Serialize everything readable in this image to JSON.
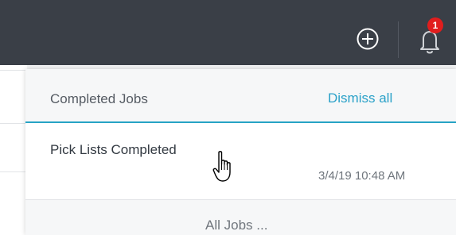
{
  "header": {
    "add_icon": "plus-circle-icon",
    "bell_icon": "bell-icon",
    "notification_count": "1"
  },
  "notifications": {
    "title": "Completed Jobs",
    "dismiss_label": "Dismiss all",
    "items": [
      {
        "title": "Pick Lists Completed",
        "timestamp": "3/4/19 10:48 AM"
      }
    ],
    "footer_link": "All Jobs ..."
  },
  "colors": {
    "topbar": "#3a3f47",
    "accent": "#26a3c5",
    "badge": "#e11d1d"
  }
}
